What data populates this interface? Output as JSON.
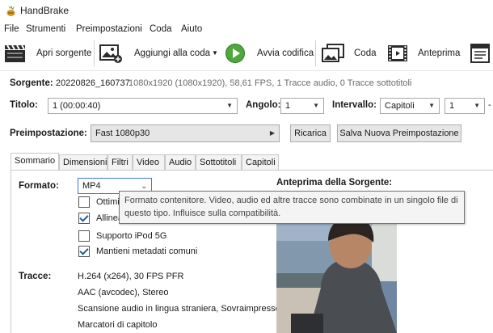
{
  "window": {
    "title": "HandBrake"
  },
  "menu": [
    "File",
    "Strumenti",
    "Preimpostazioni",
    "Coda",
    "Aiuto"
  ],
  "toolbar": {
    "open_source": "Apri sorgente",
    "add_to_queue": "Aggiungi alla coda",
    "start_encode": "Avvia codifica",
    "queue": "Coda",
    "preview": "Anteprima"
  },
  "source": {
    "label": "Sorgente:",
    "name": "20220826_160737",
    "info": "1080x1920 (1080x1920), 58,61 FPS, 1 Tracce audio, 0 Tracce sottotitoli"
  },
  "title_row": {
    "title_label": "Titolo:",
    "title_value": "1 (00:00:40)",
    "angle_label": "Angolo:",
    "angle_value": "1",
    "range_label": "Intervallo:",
    "range_type": "Capitoli",
    "range_start": "1",
    "dash": "-"
  },
  "preset": {
    "label": "Preimpostazione:",
    "value": "Fast 1080p30",
    "reload_button": "Ricarica",
    "save_button": "Salva Nuova Preimpostazione"
  },
  "tabs": [
    "Sommario",
    "Dimensioni",
    "Filtri",
    "Video",
    "Audio",
    "Sottotitoli",
    "Capitoli"
  ],
  "summary": {
    "format_label": "Formato:",
    "format_value": "MP4",
    "checkboxes": [
      {
        "label": "Ottimizzato per web",
        "checked": false
      },
      {
        "label": "Allinea inizio A/V",
        "checked": true
      },
      {
        "label": "Supporto iPod 5G",
        "checked": false
      },
      {
        "label": "Mantieni metadati comuni",
        "checked": true
      }
    ],
    "tracks_label": "Tracce:",
    "tracks": [
      "H.264 (x264), 30 FPS PFR",
      "AAC (avcodec), Stereo",
      "Scansione audio in lingua straniera, Sovraimpresso",
      "Marcatori di capitolo"
    ],
    "source_preview_label": "Anteprima della Sorgente:"
  },
  "tooltip": {
    "line1": "Formato contenitore. Video, audio ed altre tracce sono combinate in un singolo file di",
    "line2": "questo tipo. Influisce sulla compatibilità."
  },
  "icons": {
    "logo": "pineapple-logo-icon",
    "open_source": "film-clapper-icon",
    "add_to_queue": "add-image-icon",
    "start_encode": "play-icon",
    "queue": "image-stack-icon",
    "preview": "filmstrip-icon",
    "activity": "log-window-icon"
  },
  "colors": {
    "accent": "#3c8d2f",
    "tab_border": "#c8c8c8",
    "tooltip_bg": "#f4f4f4"
  }
}
